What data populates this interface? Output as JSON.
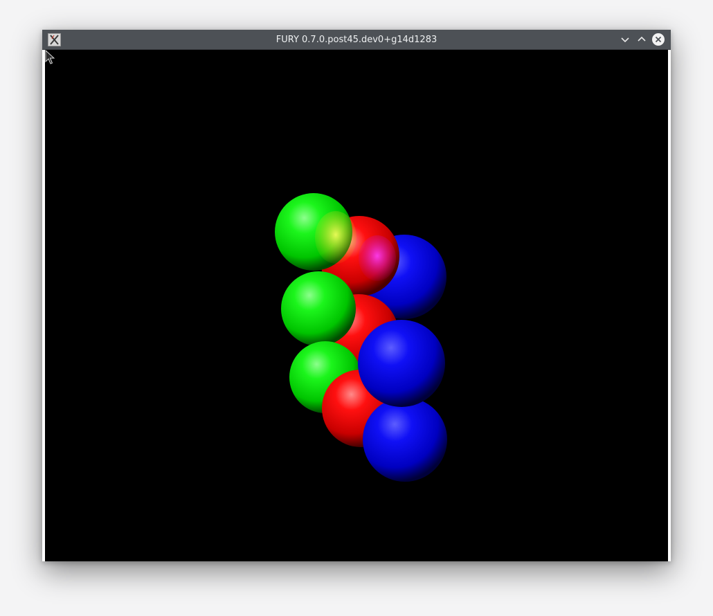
{
  "window": {
    "title": "FURY 0.7.0.post45.dev0+g14d1283",
    "icon": "x-window-icon",
    "controls": [
      "minimize-chevron-down-icon",
      "maximize-chevron-up-icon",
      "close-icon"
    ]
  },
  "scene": {
    "background": "#000000",
    "colors": {
      "red": "#ff0000",
      "green": "#00ff00",
      "blue": "#0000ff"
    },
    "sphere_count": 9
  }
}
